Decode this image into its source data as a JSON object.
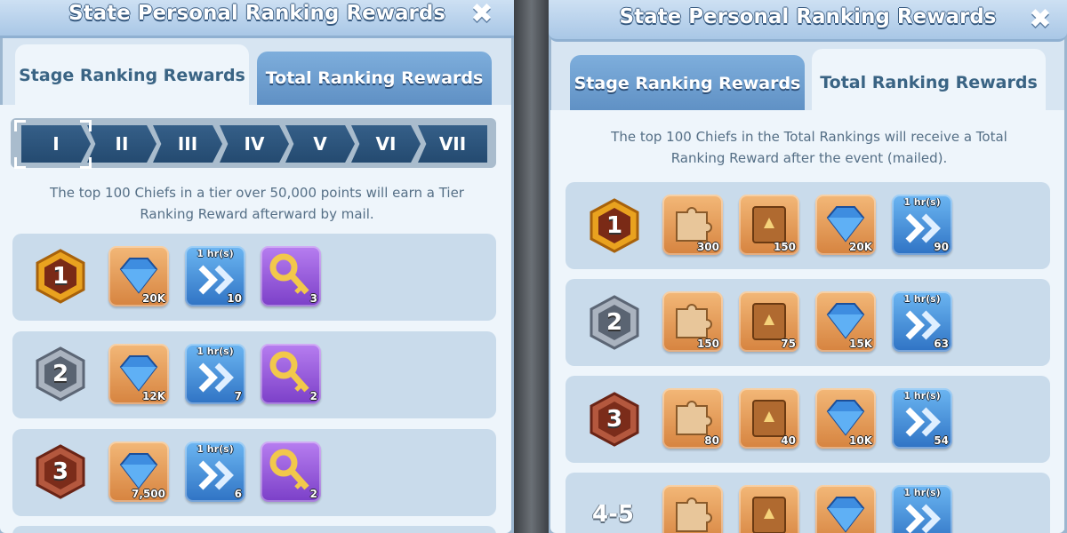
{
  "left_panel": {
    "title": "State Personal Ranking Rewards",
    "close_icon": "✖",
    "tabs": [
      {
        "label": "Stage Ranking Rewards",
        "active": true
      },
      {
        "label": "Total Ranking Rewards",
        "active": false
      }
    ],
    "tiers": [
      "I",
      "II",
      "III",
      "IV",
      "V",
      "VI",
      "VII"
    ],
    "selected_tier": "I",
    "description_line1": "The top 100 Chiefs in a tier over 50,000 points will earn a Tier",
    "description_line2": "Ranking Reward afterward by mail.",
    "rows": [
      {
        "rank": "1",
        "items": [
          {
            "icon": "diamond-icon",
            "qty": "20K",
            "color": "orange"
          },
          {
            "icon": "speedup-icon",
            "label": "1 hr(s)",
            "qty": "10",
            "color": "blue"
          },
          {
            "icon": "key-icon",
            "qty": "3",
            "color": "purple"
          }
        ]
      },
      {
        "rank": "2",
        "items": [
          {
            "icon": "diamond-icon",
            "qty": "12K",
            "color": "orange"
          },
          {
            "icon": "speedup-icon",
            "label": "1 hr(s)",
            "qty": "7",
            "color": "blue"
          },
          {
            "icon": "key-icon",
            "qty": "2",
            "color": "purple"
          }
        ]
      },
      {
        "rank": "3",
        "items": [
          {
            "icon": "diamond-icon",
            "qty": "7,500",
            "color": "orange"
          },
          {
            "icon": "speedup-icon",
            "label": "1 hr(s)",
            "qty": "6",
            "color": "blue"
          },
          {
            "icon": "key-icon",
            "qty": "2",
            "color": "purple"
          }
        ]
      }
    ]
  },
  "right_panel": {
    "title": "State Personal Ranking Rewards",
    "close_icon": "✖",
    "tabs": [
      {
        "label": "Stage Ranking Rewards",
        "active": false
      },
      {
        "label": "Total Ranking Rewards",
        "active": true
      }
    ],
    "description_line1": "The top 100 Chiefs in the Total Rankings will receive a Total",
    "description_line2": "Ranking Reward after the event (mailed).",
    "rows": [
      {
        "rank": "1",
        "items": [
          {
            "icon": "puzzle-icon",
            "qty": "300",
            "color": "orange"
          },
          {
            "icon": "book-icon",
            "qty": "150",
            "color": "orange"
          },
          {
            "icon": "diamond-icon",
            "qty": "20K",
            "color": "orange"
          },
          {
            "icon": "speedup-icon",
            "label": "1 hr(s)",
            "qty": "90",
            "color": "blue"
          }
        ]
      },
      {
        "rank": "2",
        "items": [
          {
            "icon": "puzzle-icon",
            "qty": "150",
            "color": "orange"
          },
          {
            "icon": "book-icon",
            "qty": "75",
            "color": "orange"
          },
          {
            "icon": "diamond-icon",
            "qty": "15K",
            "color": "orange"
          },
          {
            "icon": "speedup-icon",
            "label": "1 hr(s)",
            "qty": "63",
            "color": "blue"
          }
        ]
      },
      {
        "rank": "3",
        "items": [
          {
            "icon": "puzzle-icon",
            "qty": "80",
            "color": "orange"
          },
          {
            "icon": "book-icon",
            "qty": "40",
            "color": "orange"
          },
          {
            "icon": "diamond-icon",
            "qty": "10K",
            "color": "orange"
          },
          {
            "icon": "speedup-icon",
            "label": "1 hr(s)",
            "qty": "54",
            "color": "blue"
          }
        ]
      },
      {
        "rank": "4-5",
        "items": [
          {
            "icon": "puzzle-icon",
            "qty": "",
            "color": "orange"
          },
          {
            "icon": "book-icon",
            "qty": "",
            "color": "orange"
          },
          {
            "icon": "diamond-icon",
            "qty": "",
            "color": "orange"
          },
          {
            "icon": "speedup-icon",
            "label": "1 hr(s)",
            "qty": "",
            "color": "blue"
          }
        ]
      }
    ]
  },
  "colors": {
    "gold_badge": "#e9a21f",
    "silver_badge": "#7d8796",
    "bronze_badge": "#9a3f2c",
    "tier_chevron": "#2c5379"
  }
}
